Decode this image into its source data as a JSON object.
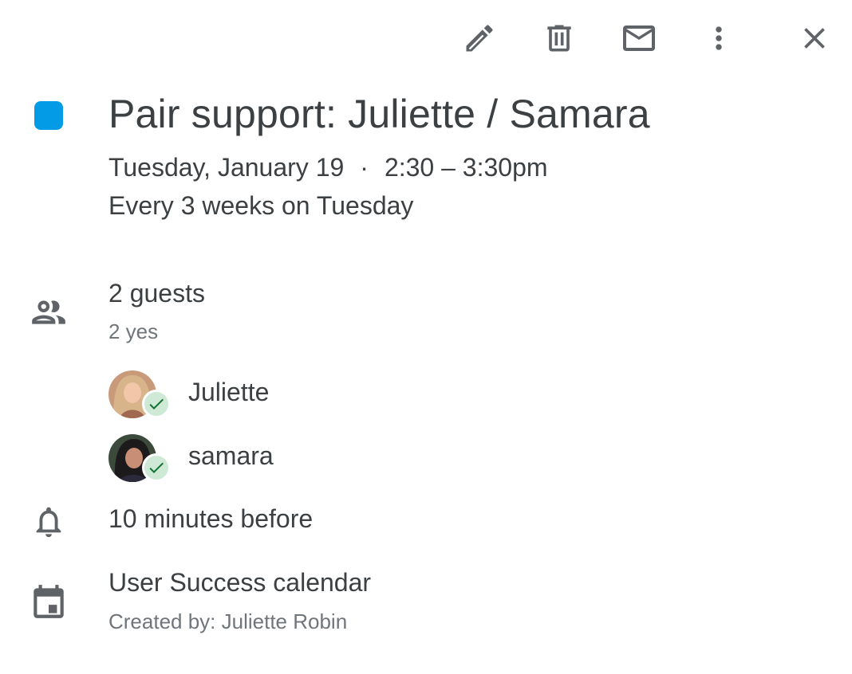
{
  "toolbar": {
    "edit_icon": "pencil-icon",
    "delete_icon": "trash-icon",
    "email_icon": "mail-icon",
    "more_icon": "more-vert-icon",
    "close_icon": "close-icon"
  },
  "event": {
    "color": "#039be5",
    "title": "Pair support: Juliette / Samara",
    "date": "Tuesday, January 19",
    "separator": "·",
    "time": "2:30 – 3:30pm",
    "recurrence": "Every 3 weeks on Tuesday"
  },
  "guests": {
    "icon": "people-icon",
    "count_label": "2 guests",
    "summary": "2 yes",
    "list": [
      {
        "name": "Juliette",
        "status": "accepted"
      },
      {
        "name": "samara",
        "status": "accepted"
      }
    ]
  },
  "reminder": {
    "icon": "bell-icon",
    "label": "10 minutes before"
  },
  "calendar": {
    "icon": "calendar-icon",
    "name": "User Success calendar",
    "created_by": "Created by: Juliette Robin"
  },
  "colors": {
    "accept_badge_bg": "#ceead6",
    "accept_check": "#137333"
  }
}
